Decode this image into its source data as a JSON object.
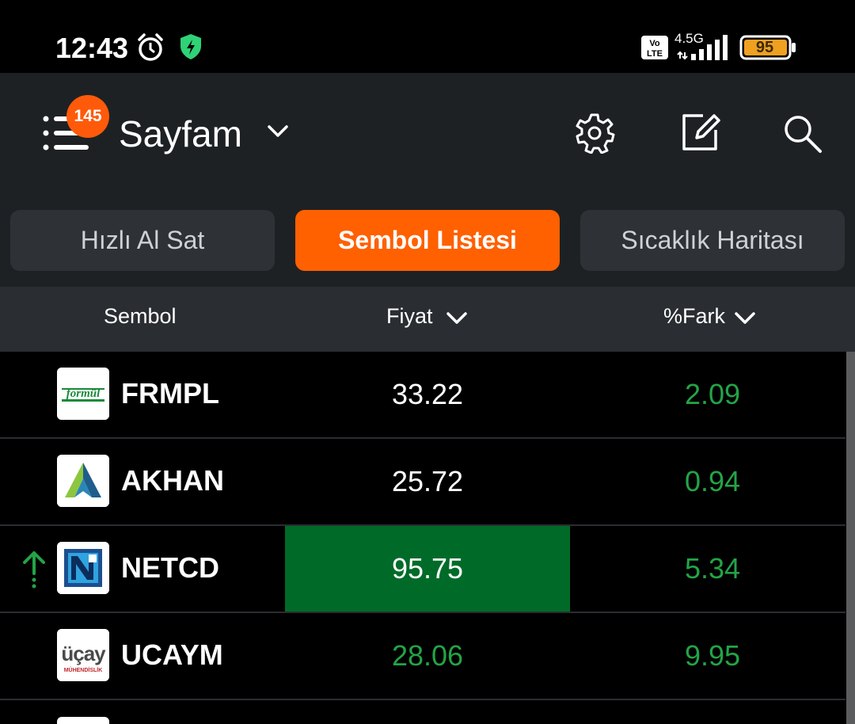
{
  "status_bar": {
    "time": "12:43",
    "network": "4.5G",
    "battery": "95",
    "icons": [
      "alarm-icon",
      "shield-icon",
      "volte-icon",
      "signal-icon",
      "battery-icon"
    ]
  },
  "header": {
    "badge_count": "145",
    "title": "Sayfam",
    "icons": [
      "menu-icon",
      "chevron-down-icon",
      "gear-icon",
      "edit-icon",
      "search-icon"
    ]
  },
  "tabs": [
    {
      "label": "Hızlı Al Sat",
      "active": false
    },
    {
      "label": "Sembol Listesi",
      "active": true
    },
    {
      "label": "Sıcaklık Haritası",
      "active": false
    }
  ],
  "table": {
    "columns": [
      {
        "label": "Sembol",
        "sortable": false
      },
      {
        "label": "Fiyat",
        "sortable": true
      },
      {
        "label": "%Fark",
        "sortable": true
      }
    ],
    "rows": [
      {
        "symbol": "FRMPL",
        "price": "33.22",
        "change": "2.09",
        "logo": "formul-logo"
      },
      {
        "symbol": "AKHAN",
        "price": "25.72",
        "change": "0.94",
        "logo": "akhan-logo"
      },
      {
        "symbol": "NETCD",
        "price": "95.75",
        "change": "5.34",
        "logo": "netcd-logo",
        "highlight": true,
        "trend": "up"
      },
      {
        "symbol": "UCAYM",
        "price": "28.06",
        "change": "9.95",
        "logo": "ucay-logo"
      }
    ],
    "logo_texts": {
      "formul": "formül",
      "ucay": "üçay",
      "ucay_sub": "MÜHENDİSLİK"
    }
  },
  "colors": {
    "accent": "#ff6000",
    "badge": "#ff5a0a",
    "positive": "#23a446",
    "highlight_bg": "#006b28",
    "header_bg": "#1e2124"
  }
}
